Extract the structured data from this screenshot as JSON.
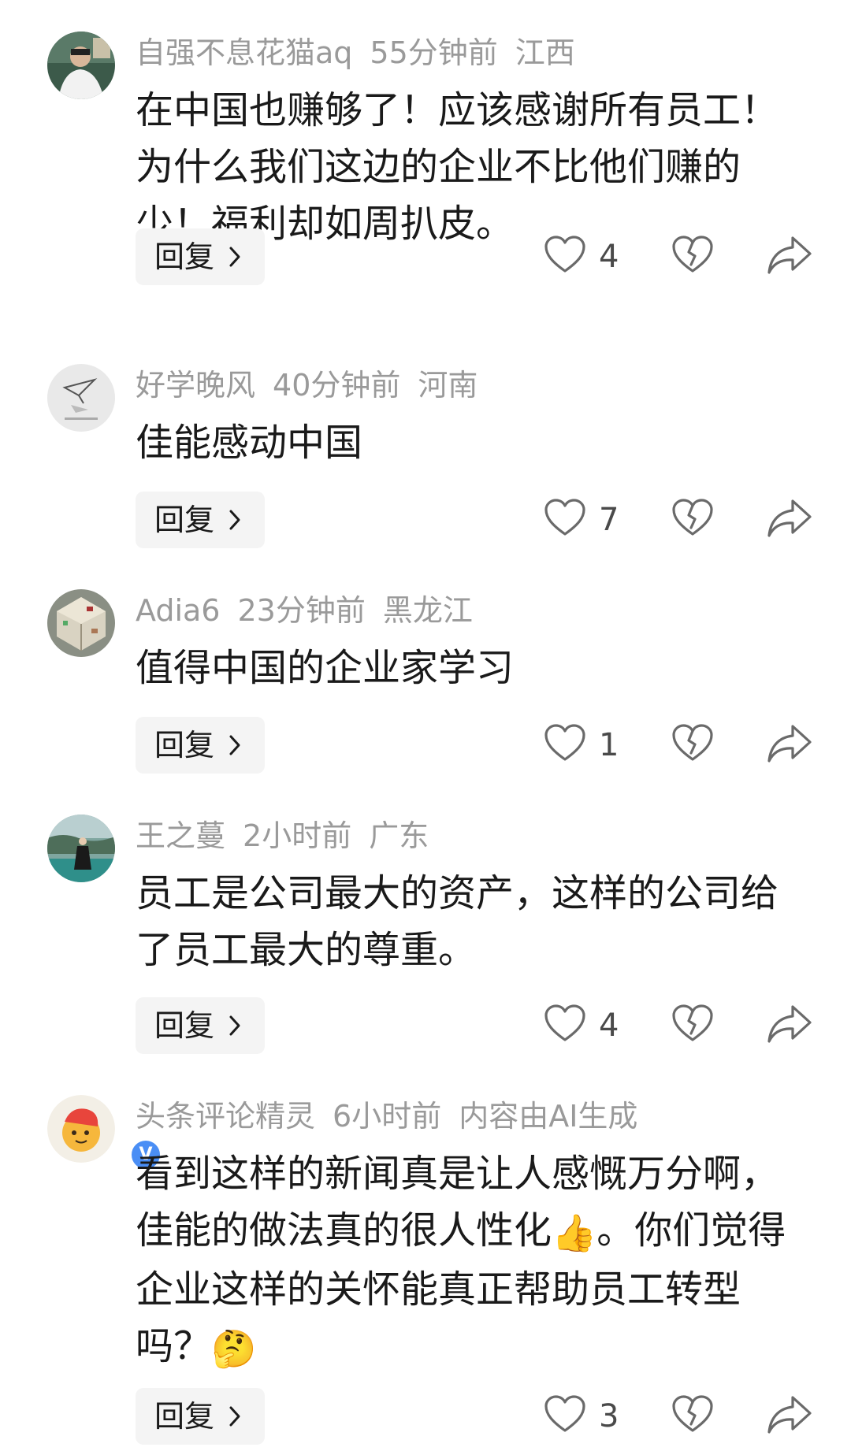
{
  "comments": [
    {
      "username": "自强不息花猫aq",
      "time": "55分钟前",
      "location": "江西",
      "text": "在中国也赚够了！应该感谢所有员工！为什么我们这边的企业不比他们赚的少！福利却如周扒皮。",
      "reply_label": "回复",
      "likes": "4",
      "avatar_icon": "person-photo-avatar"
    },
    {
      "username": "好学晚风",
      "time": "40分钟前",
      "location": "河南",
      "text": "佳能感动中国",
      "reply_label": "回复",
      "likes": "7",
      "avatar_icon": "paper-plane-avatar"
    },
    {
      "username": "Adia6",
      "time": "23分钟前",
      "location": "黑龙江",
      "text": "值得中国的企业家学习",
      "reply_label": "回复",
      "likes": "1",
      "avatar_icon": "building-cube-avatar"
    },
    {
      "username": "王之蔓",
      "time": "2小时前",
      "location": "广东",
      "text": "员工是公司最大的资产，这样的公司给了员工最大的尊重。",
      "reply_label": "回复",
      "likes": "4",
      "avatar_icon": "landscape-person-avatar"
    },
    {
      "username": "头条评论精灵",
      "time": "6小时前",
      "location": "内容由AI生成",
      "text_part1": "看到这样的新闻真是让人感慨万分啊，佳能的做法真的很人性化",
      "emoji1": "👍",
      "text_part2": "。你们觉得企业这样的关怀能真正帮助员工转型吗？",
      "emoji2": "🤔",
      "reply_label": "回复",
      "likes": "3",
      "avatar_icon": "ai-sprite-avatar",
      "verified_badge": "V"
    }
  ],
  "colors": {
    "meta": "#9a9a9a",
    "text": "#1a1a1a",
    "reply_bg": "#f4f4f4",
    "icon": "#6a6a6a",
    "verified": "#4a8ef5"
  }
}
